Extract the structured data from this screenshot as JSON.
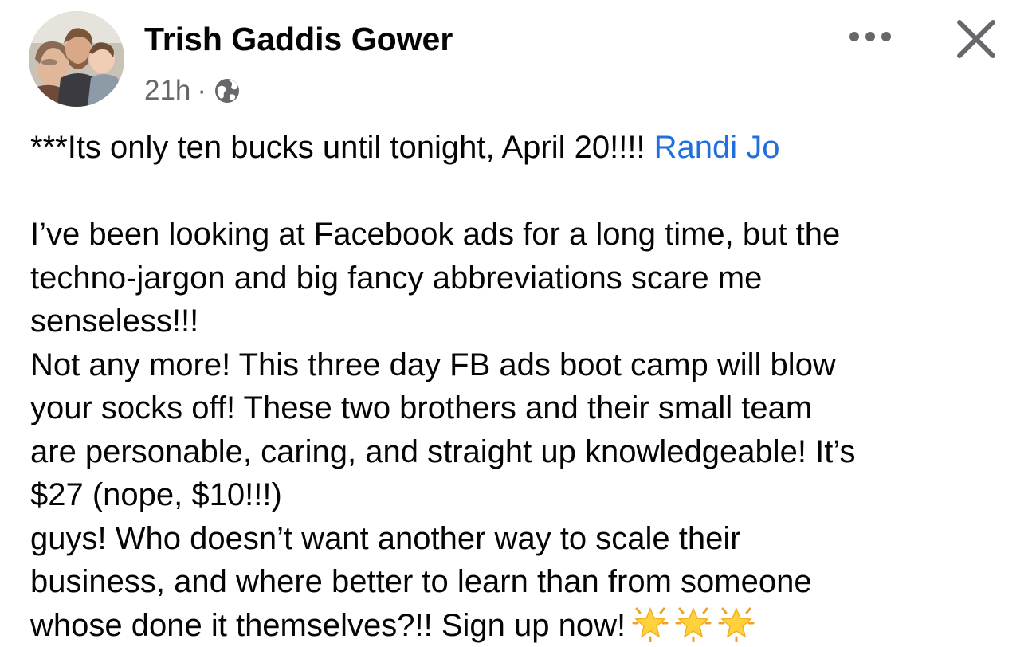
{
  "post": {
    "author_name": "Trish Gaddis Gower",
    "timestamp": "21h",
    "separator": "·",
    "audience_icon": "globe-icon",
    "actions": {
      "more_icon": "more-horizontal-icon",
      "close_icon": "close-icon"
    },
    "text": {
      "line1_prefix": "***Its only ten bucks until tonight, April 20!!!! ",
      "mention": "Randi Jo",
      "lines": [
        " I’ve been looking at Facebook ads for a long time, but the",
        "techno-jargon and big fancy abbreviations scare me",
        "senseless!!!",
        "Not any more! This three day FB ads boot camp will blow",
        "your socks off! These two brothers and their small team",
        "are personable, caring, and straight up knowledgeable! It’s",
        "$27 (nope, $10!!!)",
        "guys! Who doesn’t want another way to scale their",
        "business, and where better to learn than from someone"
      ],
      "last_line": "whose done it themselves?!! Sign up now!",
      "emoji": [
        "glowing-star-icon",
        "glowing-star-icon",
        "glowing-star-icon"
      ]
    },
    "colors": {
      "text": "#050505",
      "secondary": "#65676b",
      "link": "#216fdb",
      "star_fill": "#ffd23d",
      "star_rays": "#f0a020"
    }
  }
}
